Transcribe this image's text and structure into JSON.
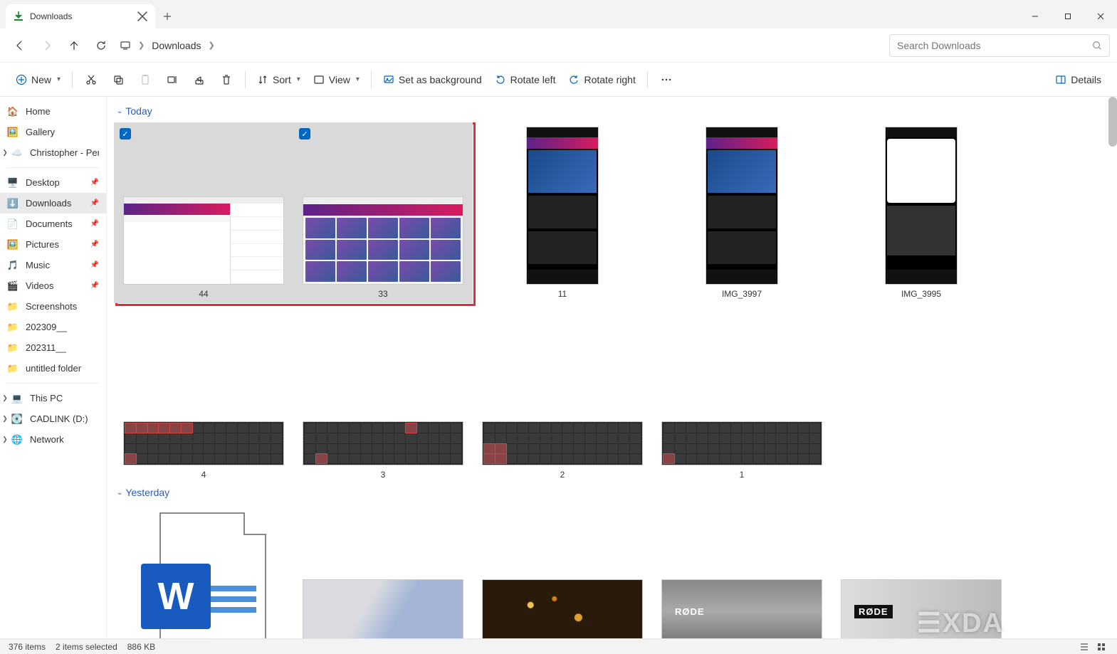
{
  "titlebar": {
    "tab_title": "Downloads"
  },
  "nav": {
    "breadcrumb_current": "Downloads",
    "search_placeholder": "Search Downloads"
  },
  "cmd": {
    "new": "New",
    "sort": "Sort",
    "view": "View",
    "set_bg": "Set as background",
    "rot_left": "Rotate left",
    "rot_right": "Rotate right",
    "details": "Details"
  },
  "sidebar": {
    "home": "Home",
    "gallery": "Gallery",
    "onedrive": "Christopher - Perso",
    "desktop": "Desktop",
    "downloads": "Downloads",
    "documents": "Documents",
    "pictures": "Pictures",
    "music": "Music",
    "videos": "Videos",
    "screenshots": "Screenshots",
    "f1": "202309__",
    "f2": "202311__",
    "f3": "untitled folder",
    "thispc": "This PC",
    "cadlink": "CADLINK (D:)",
    "network": "Network"
  },
  "groups": {
    "today": "Today",
    "yesterday": "Yesterday"
  },
  "files": {
    "today": [
      {
        "name": "44",
        "selected": true,
        "kind": "wide-split"
      },
      {
        "name": "33",
        "selected": true,
        "kind": "wide"
      },
      {
        "name": "11",
        "selected": false,
        "kind": "tall"
      },
      {
        "name": "IMG_3997",
        "selected": false,
        "kind": "tall"
      },
      {
        "name": "IMG_3995",
        "selected": false,
        "kind": "tall-dark"
      },
      {
        "name": "4",
        "selected": false,
        "kind": "kb"
      },
      {
        "name": "3",
        "selected": false,
        "kind": "kb"
      },
      {
        "name": "2",
        "selected": false,
        "kind": "kb"
      },
      {
        "name": "1",
        "selected": false,
        "kind": "kb"
      }
    ],
    "yesterday_label_rode": "RØDE"
  },
  "status": {
    "items": "376 items",
    "selected": "2 items selected",
    "size": "886 KB"
  },
  "watermark": "XDA"
}
